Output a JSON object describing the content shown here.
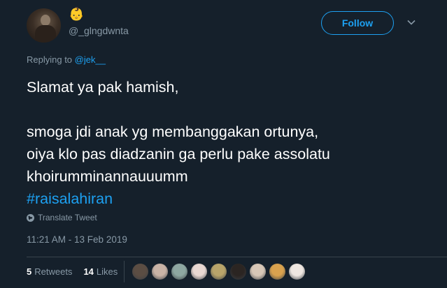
{
  "author": {
    "name_emoji": "👶",
    "handle": "@_glngdwnta"
  },
  "follow_button": {
    "label": "Follow"
  },
  "reply": {
    "prefix": "Replying to",
    "to_handle": "@jek__"
  },
  "tweet": {
    "lines": [
      "Slamat ya pak hamish,",
      "",
      "smoga jdi anak yg membanggakan ortunya,",
      "oiya klo pas diadzanin ga perlu pake assolatu",
      "khoirumminannauuumm"
    ],
    "hashtag": "#raisalahiran"
  },
  "translate_label": "Translate Tweet",
  "timestamp": "11:21 AM - 13 Feb 2019",
  "stats": {
    "retweets_count": "5",
    "retweets_label": "Retweets",
    "likes_count": "14",
    "likes_label": "Likes"
  },
  "colors": {
    "background": "#15202b",
    "accent": "#1da1f2",
    "muted": "#8899a6",
    "divider": "#38444d"
  },
  "likers": [
    {
      "name": "liker-avatar-1",
      "color": "#5b4d43"
    },
    {
      "name": "liker-avatar-2",
      "color": "#c9b3a6"
    },
    {
      "name": "liker-avatar-3",
      "color": "#8ea7a1"
    },
    {
      "name": "liker-avatar-4",
      "color": "#e8d8d2"
    },
    {
      "name": "liker-avatar-5",
      "color": "#b8a46a"
    },
    {
      "name": "liker-avatar-6",
      "color": "#2b2522"
    },
    {
      "name": "liker-avatar-7",
      "color": "#d7c7b7"
    },
    {
      "name": "liker-avatar-8",
      "color": "#d9a24e"
    },
    {
      "name": "liker-avatar-9",
      "color": "#efe7e1"
    }
  ]
}
